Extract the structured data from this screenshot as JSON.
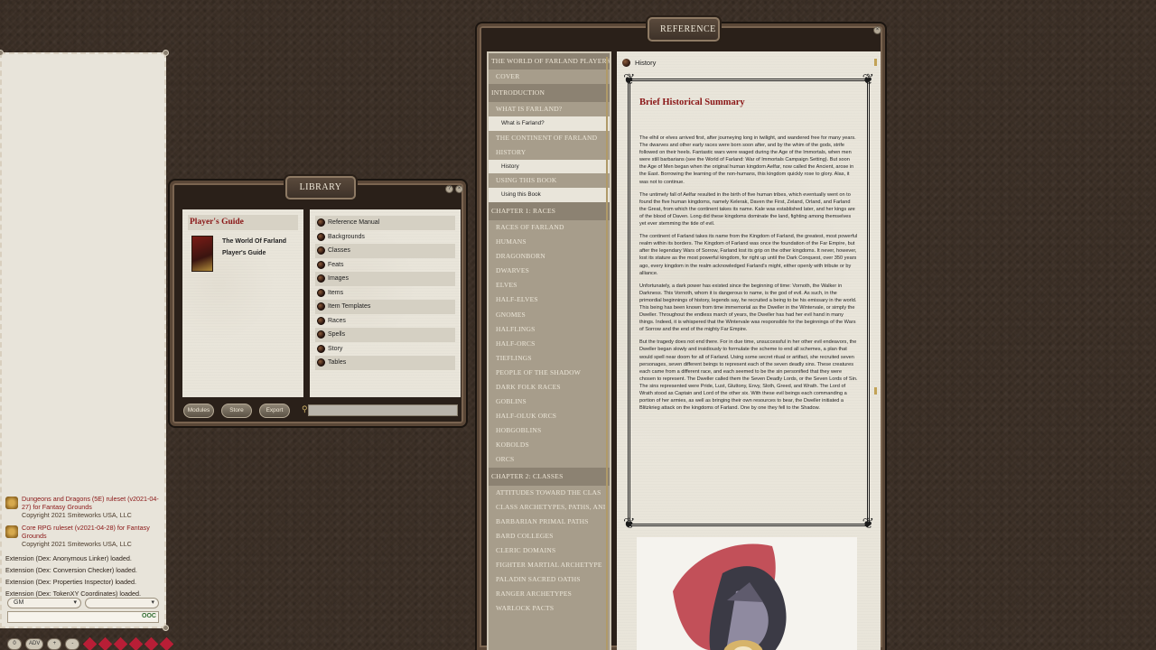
{
  "chat": {
    "rulesets": [
      {
        "title": "Dungeons and Dragons (5E) ruleset (v2021-04-27) for Fantasy Grounds",
        "copyright": "Copyright 2021 Smiteworks USA, LLC"
      },
      {
        "title": "Core RPG ruleset (v2021-04-28) for Fantasy Grounds",
        "copyright": "Copyright 2021 Smiteworks USA, LLC"
      }
    ],
    "extensions": [
      "Extension (Dex: Anonymous Linker) loaded.",
      "Extension (Dex: Conversion Checker) loaded.",
      "Extension (Dex: Properties Inspector) loaded.",
      "Extension (Dex: TokenXY Coordinates) loaded."
    ],
    "identity_select": "GM",
    "language_select": "",
    "occ_label": "OOC"
  },
  "hotbar": {
    "buttons": [
      "0",
      "ADV",
      "+",
      "-"
    ]
  },
  "library": {
    "title": "LIBRARY",
    "books_header": "Player's Guide",
    "book_title_line1": "The World Of Farland",
    "book_title_line2": "Player's Guide",
    "categories": [
      "Reference Manual",
      "Backgrounds",
      "Classes",
      "Feats",
      "Images",
      "Items",
      "Item Templates",
      "Races",
      "Spells",
      "Story",
      "Tables"
    ],
    "footer_buttons": [
      "Modules",
      "Store",
      "Export"
    ],
    "search_value": ""
  },
  "reference": {
    "title": "REFERENCE",
    "toc": [
      {
        "label": "THE WORLD OF FARLAND PLAYERS",
        "kind": "top"
      },
      {
        "label": "COVER",
        "kind": "item"
      },
      {
        "label": "INTRODUCTION",
        "kind": "section"
      },
      {
        "label": "WHAT IS FARLAND?",
        "kind": "item"
      },
      {
        "label": "What is Farland?",
        "kind": "page"
      },
      {
        "label": "THE CONTINENT OF FARLAND",
        "kind": "item"
      },
      {
        "label": "HISTORY",
        "kind": "item"
      },
      {
        "label": "History",
        "kind": "page"
      },
      {
        "label": "USING THIS BOOK",
        "kind": "item"
      },
      {
        "label": "Using this Book",
        "kind": "page"
      },
      {
        "label": "CHAPTER 1: RACES",
        "kind": "section"
      },
      {
        "label": "RACES OF FARLAND",
        "kind": "item"
      },
      {
        "label": "HUMANS",
        "kind": "item"
      },
      {
        "label": "DRAGONBORN",
        "kind": "item"
      },
      {
        "label": "DWARVES",
        "kind": "item"
      },
      {
        "label": "ELVES",
        "kind": "item"
      },
      {
        "label": "HALF-ELVES",
        "kind": "item"
      },
      {
        "label": "GNOMES",
        "kind": "item"
      },
      {
        "label": "HALFLINGS",
        "kind": "item"
      },
      {
        "label": "HALF-ORCS",
        "kind": "item"
      },
      {
        "label": "TIEFLINGS",
        "kind": "item"
      },
      {
        "label": "PEOPLE OF THE SHADOW",
        "kind": "item"
      },
      {
        "label": "DARK FOLK RACES",
        "kind": "item"
      },
      {
        "label": "GOBLINS",
        "kind": "item"
      },
      {
        "label": "HALF-OLUK ORCS",
        "kind": "item"
      },
      {
        "label": "HOBGOBLINS",
        "kind": "item"
      },
      {
        "label": "KOBOLDS",
        "kind": "item"
      },
      {
        "label": "ORCS",
        "kind": "item"
      },
      {
        "label": "CHAPTER 2: CLASSES",
        "kind": "section"
      },
      {
        "label": "ATTITUDES TOWARD THE CLAS",
        "kind": "item"
      },
      {
        "label": "CLASS ARCHETYPES, PATHS, ANI",
        "kind": "item"
      },
      {
        "label": "BARBARIAN PRIMAL PATHS",
        "kind": "item"
      },
      {
        "label": "BARD COLLEGES",
        "kind": "item"
      },
      {
        "label": "CLERIC DOMAINS",
        "kind": "item"
      },
      {
        "label": "FIGHTER MARTIAL ARCHETYPE",
        "kind": "item"
      },
      {
        "label": "PALADIN SACRED OATHS",
        "kind": "item"
      },
      {
        "label": "RANGER ARCHETYPES",
        "kind": "item"
      },
      {
        "label": "WARLOCK PACTS",
        "kind": "item"
      }
    ],
    "page_crumb": "History",
    "heading": "Brief Historical Summary",
    "paragraphs": [
      "The elhil or elves arrived first, after journeying long in twilight, and wandered free for many years. The dwarves and other early races were born soon after, and by the whim of the gods, strife followed on their heels. Fantastic wars were waged during the Age of the Immortals, when men were still barbarians (see the World of Farland: War of Immortals Campaign Setting). But soon the Age of Men began when the original human kingdom Aelfar, now called the Ancient, arose in the East. Borrowing the learning of the non-humans, this kingdom quickly rose to glory. Alas, it was not to continue.",
      "The untimely fall of Aelfar resulted in the birth of five human tribes, which eventually went on to found the five human kingdoms, namely Kelerak, Daven the First, Zeland, Orland, and Farland the Great, from which the continent takes its name. Kale was established later, and her kings are of the blood of Daven. Long did these kingdoms dominate the land, fighting among themselves yet ever stemming the tide of evil.",
      "The continent of Farland takes its name from the Kingdom of Farland, the greatest, most powerful realm within its borders. The Kingdom of Farland was once the foundation of the Far Empire, but after the legendary Wars of Sorrow, Farland lost its grip on the other kingdoms. It never, however, lost its stature as the most powerful kingdom, for right up until the Dark Conquest, over 350 years ago, every kingdom in the realm acknowledged Farland's might, either openly with tribute or by alliance.",
      "Unfortunately, a dark power has existed since the beginning of time: Vornoth, the Walker in Darkness. This Vornoth, whom it is dangerous to name, is the god of evil. As such, in the primordial beginnings of history, legends say, he recruited a being to be his emissary in the world. This being has been known from time immemorial as the Dweller in the Wintervale, or simply the Dweller. Throughout the endless march of years, the Dweller has had her evil hand in many things. Indeed, it is whispered that the Wintervale was responsible for the beginnings of the Wars of Sorrow and the end of the mighty Far Empire.",
      "But the tragedy does not end there. For in due time, unsuccessful in her other evil endeavors, the Dweller began slowly and insidiously to formulate the scheme to end all schemes, a plan that would spell near doom for all of Farland. Using some secret ritual or artifact, she recruited seven personages, seven different beings to represent each of the seven deadly sins. These creatures each came from a different race, and each seemed to be the sin personified that they were chosen to represent. The Dweller called them the Seven Deadly Lords, or the Seven Lords of Sin. The sins represented were Pride, Lust, Gluttony, Envy, Sloth, Greed, and Wrath. The Lord of Wrath stood as Captain and Lord of the other six. With these evil beings each commanding a portion of her armies, as well as bringing their own resources to bear, the Dweller initiated a Blitzkrieg attack on the kingdoms of Farland. One by one they fell to the Shadow."
    ]
  }
}
